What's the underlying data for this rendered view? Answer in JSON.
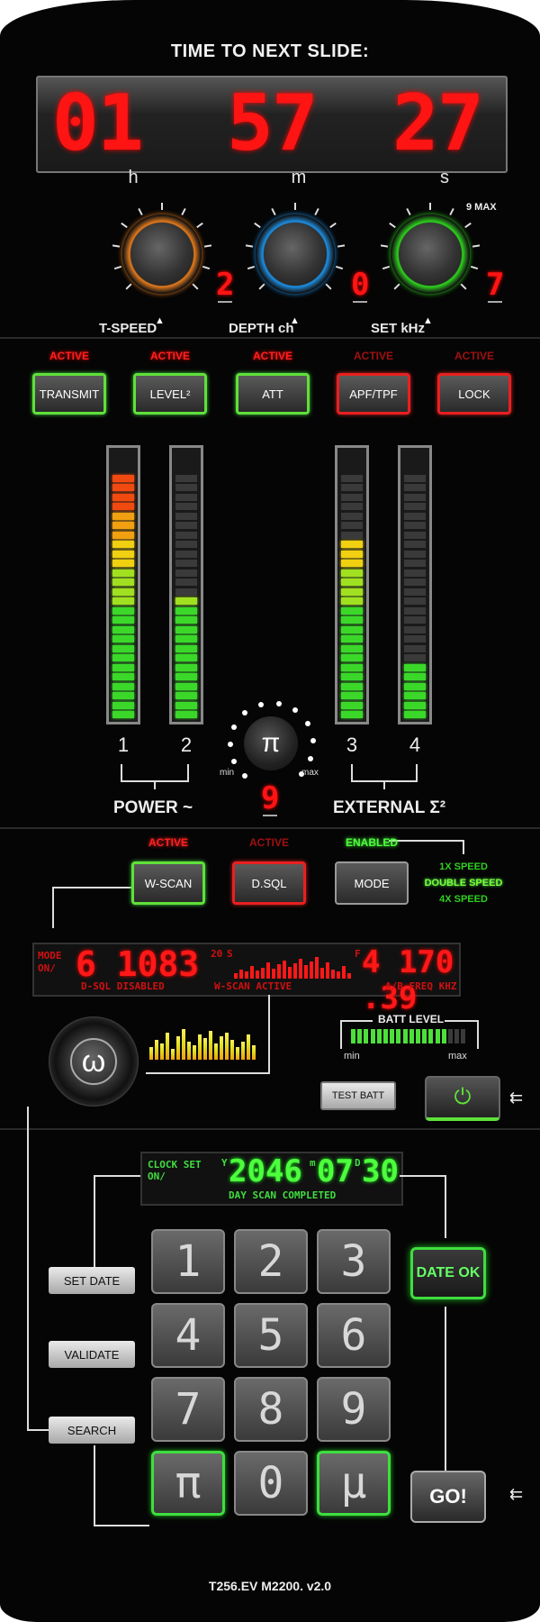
{
  "header": {
    "title": "TIME TO NEXT SLIDE:"
  },
  "timer": {
    "hours": "01",
    "minutes": "57",
    "seconds": "27",
    "h_label": "h",
    "m_label": "m",
    "s_label": "s"
  },
  "knobs": [
    {
      "label": "T-SPEED",
      "value": "2",
      "color": "#e07a1f"
    },
    {
      "label": "DEPTH ch",
      "value": "0",
      "color": "#1f8ee0"
    },
    {
      "label": "SET kHz",
      "value": "7",
      "color": "#2fd01f",
      "max_label": "9 MAX"
    }
  ],
  "modes": [
    {
      "status": "ACTIVE",
      "label": "TRANSMIT",
      "state": "on"
    },
    {
      "status": "ACTIVE",
      "label": "LEVEL²",
      "state": "on"
    },
    {
      "status": "ACTIVE",
      "label": "ATT",
      "state": "on"
    },
    {
      "status": "ACTIVE",
      "label": "APF/TPF",
      "state": "off"
    },
    {
      "status": "ACTIVE",
      "label": "LOCK",
      "state": "off"
    }
  ],
  "meters": [
    {
      "channel": "1",
      "level_segments": 26,
      "total_segments": 26
    },
    {
      "channel": "2",
      "level_segments": 13,
      "total_segments": 26
    },
    {
      "channel": "3",
      "level_segments": 19,
      "total_segments": 26
    },
    {
      "channel": "4",
      "level_segments": 6,
      "total_segments": 26
    }
  ],
  "pi_dial": {
    "symbol": "π",
    "min_label": "min",
    "max_label": "max",
    "value": "9"
  },
  "groups": {
    "power": "POWER ~",
    "external": "EXTERNAL Σ²"
  },
  "scan_buttons": [
    {
      "status": "ACTIVE",
      "label": "W-SCAN",
      "state": "on"
    },
    {
      "status": "ACTIVE",
      "label": "D.SQL",
      "state": "off"
    },
    {
      "status": "ENABLED",
      "label": "MODE",
      "state": "neutral"
    }
  ],
  "speeds": [
    "1X SPEED",
    "DOUBLE SPEED",
    "4X SPEED"
  ],
  "scan_lcd": {
    "mode_label": "MODE",
    "on_label": "ON/",
    "left_value": "6 1083",
    "left_sup": "20",
    "s_label": "S",
    "right_f": "F",
    "right_value": "4 170 .39",
    "footer_left": "D-SQL DISABLED",
    "footer_mid": "W-SCAN ACTIVE",
    "footer_right": "A/B FREQ KHZ"
  },
  "omega": {
    "symbol": "ω"
  },
  "battery": {
    "title": "BATT LEVEL",
    "min_label": "min",
    "max_label": "max",
    "level": 0.8,
    "test_label": "TEST BATT"
  },
  "clock_lcd": {
    "title": "CLOCK SET",
    "on_label": "ON/",
    "y_label": "Y",
    "year": "2046",
    "m_label": "m",
    "month": "07",
    "d_label": "D",
    "day": "30",
    "status": "DAY SCAN COMPLETED"
  },
  "side_buttons": {
    "set_date": "SET DATE",
    "validate": "VALIDATE",
    "search": "SEARCH"
  },
  "keypad": [
    "1",
    "2",
    "3",
    "4",
    "5",
    "6",
    "7",
    "8",
    "9",
    "π",
    "0",
    "µ"
  ],
  "date_ok": "DATE OK",
  "go": "GO!",
  "footer": {
    "version": "T256.EV M2200. v2.0"
  },
  "colors": {
    "red": "#ff1414",
    "green": "#3fdd3f",
    "orange": "#e07a1f",
    "blue": "#1f8ee0"
  }
}
